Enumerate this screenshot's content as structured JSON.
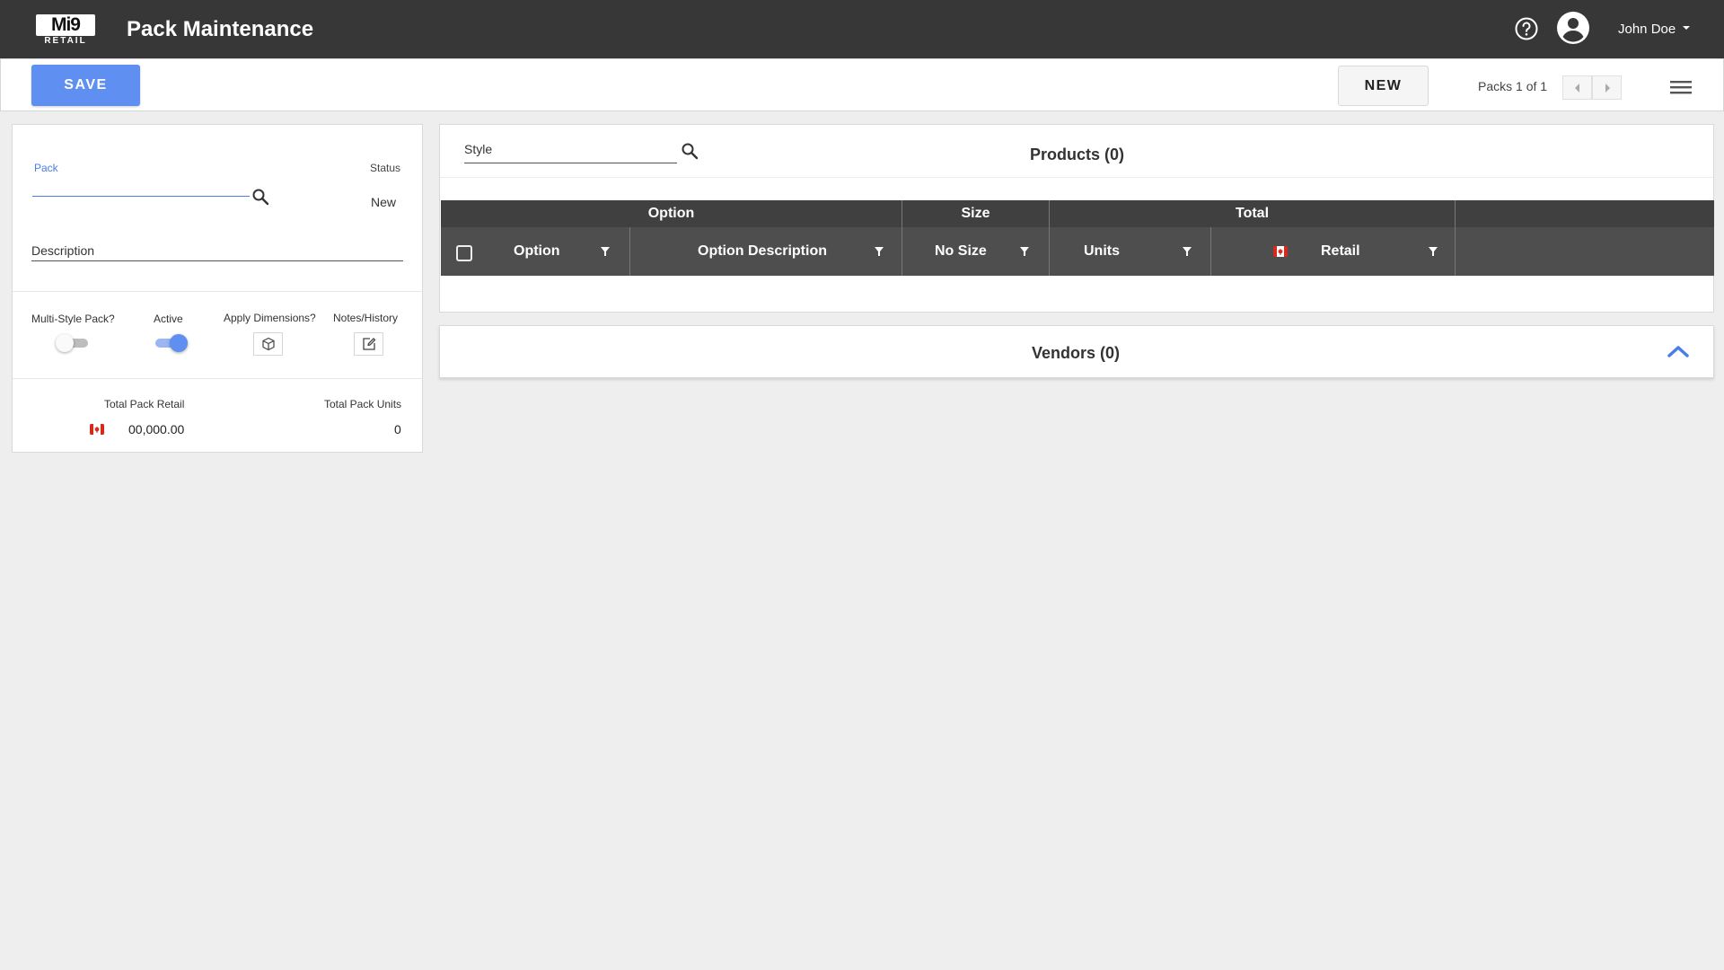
{
  "header": {
    "logo_text": "Mi9",
    "logo_subtext": "RETAIL",
    "app_title": "Pack Maintenance",
    "user_name": "John Doe",
    "icons": [
      "help-icon",
      "user-account-icon",
      "caret-down-icon"
    ]
  },
  "toolbar": {
    "save_label": "SAVE",
    "new_label": "NEW",
    "packs_count": "Packs 1 of 1",
    "icons": [
      "chevron-left-icon",
      "chevron-right-icon",
      "menu-icon"
    ]
  },
  "pack_form": {
    "pack_label": "Pack",
    "pack_value": "",
    "status_label": "Status",
    "status_value": "New",
    "description_label": "Description",
    "multi_style_label": "Multi-Style Pack?",
    "multi_style_on": false,
    "active_label": "Active",
    "active_on": true,
    "apply_dimensions_label": "Apply Dimensions?",
    "notes_history_label": "Notes/History",
    "total_pack_retail_label": "Total Pack Retail",
    "total_pack_retail_value": "00,000.00",
    "total_pack_units_label": "Total Pack Units",
    "total_pack_units_value": "0"
  },
  "products": {
    "style_label": "Style",
    "title": "Products (0)",
    "column_groups": [
      "Option",
      "Size",
      "Total"
    ],
    "columns": [
      "Option",
      "Option Description",
      "No Size",
      "Units",
      "Retail"
    ],
    "rows": []
  },
  "vendors": {
    "title": "Vendors (0)"
  },
  "colors": {
    "header_bg": "#373737",
    "accent": "#5f8ff0",
    "grid_header_bg": "#404040"
  }
}
